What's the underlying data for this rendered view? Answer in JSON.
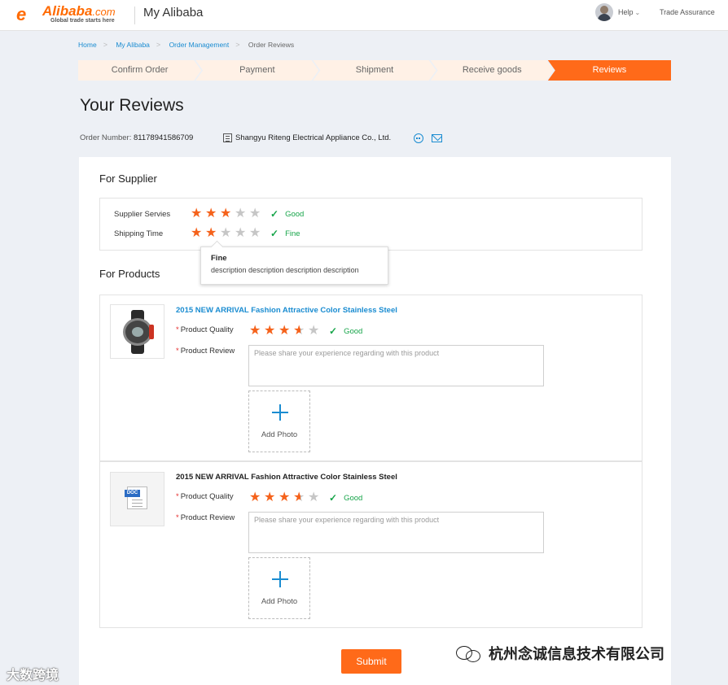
{
  "header": {
    "logo_brand": "Alibaba",
    "logo_com": ".com",
    "logo_tagline": "Global trade starts here",
    "title": "My Alibaba",
    "help": "Help",
    "trade_assurance": "Trade Assurance"
  },
  "breadcrumb": [
    "Home",
    "My Alibaba",
    "Order Management",
    "Order Reviews"
  ],
  "steps": [
    "Confirm Order",
    "Payment",
    "Shipment",
    "Receive goods",
    "Reviews"
  ],
  "active_step": "Reviews",
  "page_title": "Your Reviews",
  "order": {
    "label": "Order Number:",
    "number": "81178941586709",
    "company": "Shangyu Riteng Electrical Appliance Co., Ltd."
  },
  "supplier": {
    "section_title": "For Supplier",
    "rows": [
      {
        "label": "Supplier Servies",
        "rating": 3,
        "text": "Good"
      },
      {
        "label": "Shipping Time",
        "rating": 2,
        "text": "Fine"
      }
    ],
    "tooltip": {
      "title": "Fine",
      "desc": "description description description description"
    }
  },
  "products": {
    "section_title": "For Products",
    "items": [
      {
        "name": "2015 NEW ARRIVAL Fashion Attractive Color Stainless Steel",
        "quality_label": "Product Quality",
        "rating": 3.5,
        "rating_text": "Good",
        "review_label": "Product Review",
        "placeholder": "Please share your experience regarding with this product",
        "add_photo": "Add Photo"
      },
      {
        "name": "2015 NEW ARRIVAL Fashion Attractive Color Stainless Steel",
        "quality_label": "Product Quality",
        "rating": 3.5,
        "rating_text": "Good",
        "review_label": "Product Review",
        "placeholder": "Please share your experience regarding with this product",
        "add_photo": "Add Photo",
        "thumb_label": "DOC"
      }
    ]
  },
  "submit": "Submit",
  "watermarks": {
    "left": "大数跨境",
    "right": "杭州念诚信息技术有限公司"
  },
  "colors": {
    "accent": "#ff6a19",
    "link": "#1a8cd1",
    "success": "#17a54a",
    "step_bg": "#fff1e6"
  }
}
